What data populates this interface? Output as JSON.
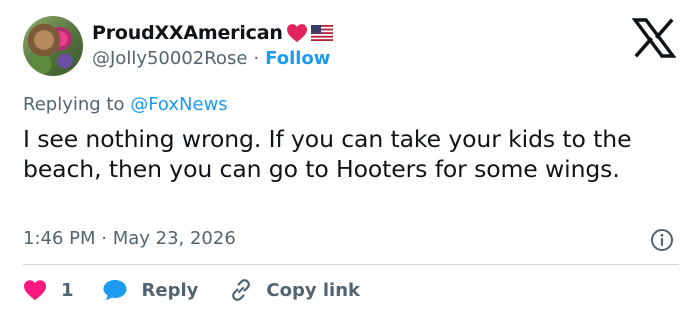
{
  "author": {
    "display_name": "ProudXXAmerican",
    "handle": "@Jolly50002Rose",
    "separator": "·",
    "follow_label": "Follow"
  },
  "reply": {
    "prefix": "Replying to",
    "mention": "@FoxNews"
  },
  "tweet": {
    "text": "I see nothing wrong. If you can take your kids to the beach, then you can go to Hooters for some wings.",
    "timestamp": "1:46 PM · May 23, 2026"
  },
  "actions": {
    "like_count": "1",
    "reply_label": "Reply",
    "copy_label": "Copy link"
  },
  "icons": {
    "brand": "x-logo-icon",
    "heart_emoji": "red-heart-icon",
    "flag_emoji": "us-flag-icon",
    "info": "info-icon",
    "like": "heart-icon",
    "reply": "reply-bubble-icon",
    "copy": "link-icon"
  },
  "colors": {
    "accent": "#1d9bf0",
    "secondary_text": "#536471",
    "like": "#f91880",
    "heart_emoji": "#e0245e"
  }
}
